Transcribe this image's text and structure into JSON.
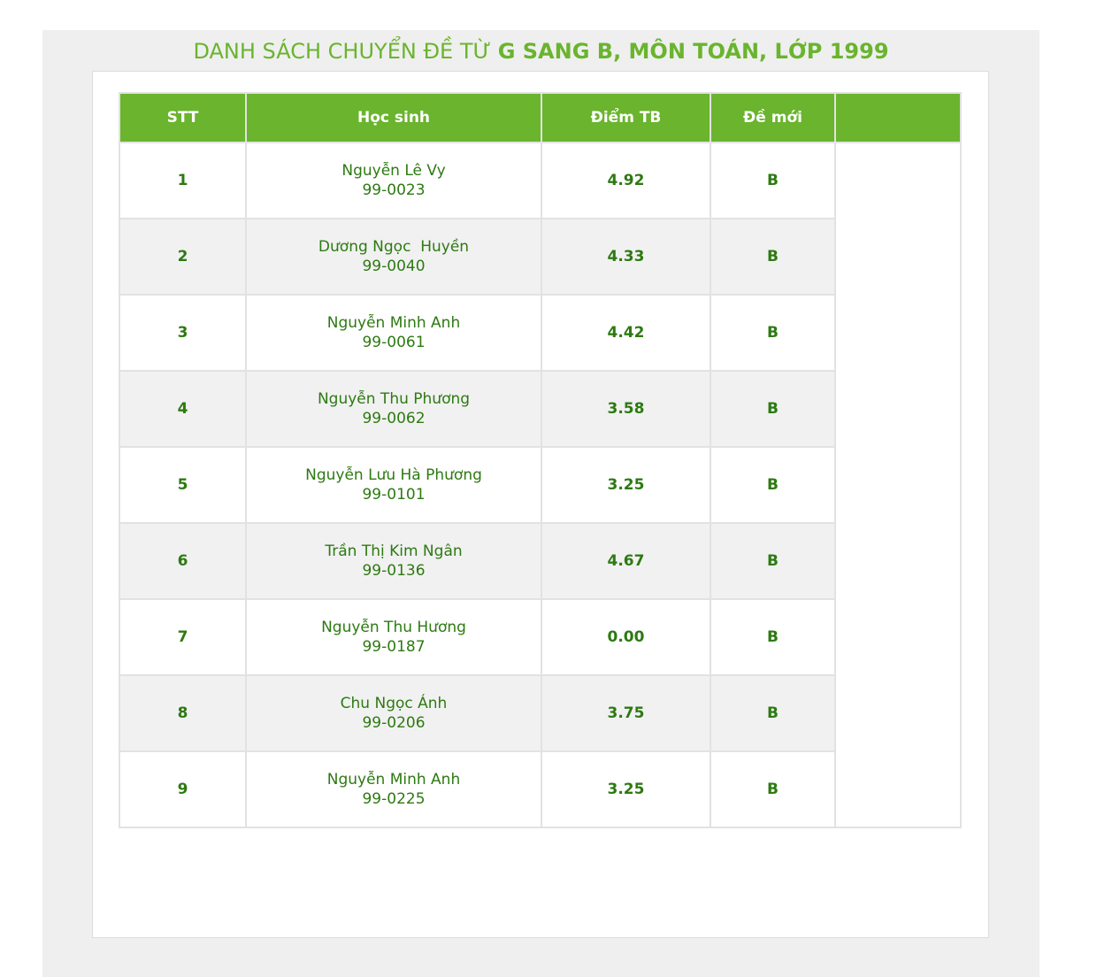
{
  "title": {
    "normal_text": "DANH SÁCH CHUYỂN ĐỀ TỪ ",
    "bold_text": "G SANG B, MÔN TOÁN, LỚP 1999"
  },
  "table": {
    "headers": {
      "stt": "STT",
      "student": "Học sinh",
      "score": "Điểm TB",
      "new_topic": "Đề mới",
      "extra": ""
    },
    "rows": [
      {
        "stt": "1",
        "name": "Nguyễn Lê Vy",
        "id": "99-0023",
        "score": "4.92",
        "new_topic": "B"
      },
      {
        "stt": "2",
        "name": "Dương Ngọc  Huyền",
        "id": "99-0040",
        "score": "4.33",
        "new_topic": "B"
      },
      {
        "stt": "3",
        "name": "Nguyễn Minh Anh",
        "id": "99-0061",
        "score": "4.42",
        "new_topic": "B"
      },
      {
        "stt": "4",
        "name": "Nguyễn Thu Phương",
        "id": "99-0062",
        "score": "3.58",
        "new_topic": "B"
      },
      {
        "stt": "5",
        "name": "Nguyễn Lưu Hà Phương",
        "id": "99-0101",
        "score": "3.25",
        "new_topic": "B"
      },
      {
        "stt": "6",
        "name": "Trần Thị Kim Ngân",
        "id": "99-0136",
        "score": "4.67",
        "new_topic": "B"
      },
      {
        "stt": "7",
        "name": "Nguyễn Thu Hương",
        "id": "99-0187",
        "score": "0.00",
        "new_topic": "B"
      },
      {
        "stt": "8",
        "name": "Chu Ngọc Ánh",
        "id": "99-0206",
        "score": "3.75",
        "new_topic": "B"
      },
      {
        "stt": "9",
        "name": "Nguyễn Minh Anh",
        "id": "99-0225",
        "score": "3.25",
        "new_topic": "B"
      }
    ]
  },
  "colors": {
    "header_bg": "#6ab42e",
    "title_text": "#6ab42e",
    "cell_text": "#2d7a12",
    "alt_row_bg": "#f1f1f1",
    "page_bg": "#efefef"
  }
}
